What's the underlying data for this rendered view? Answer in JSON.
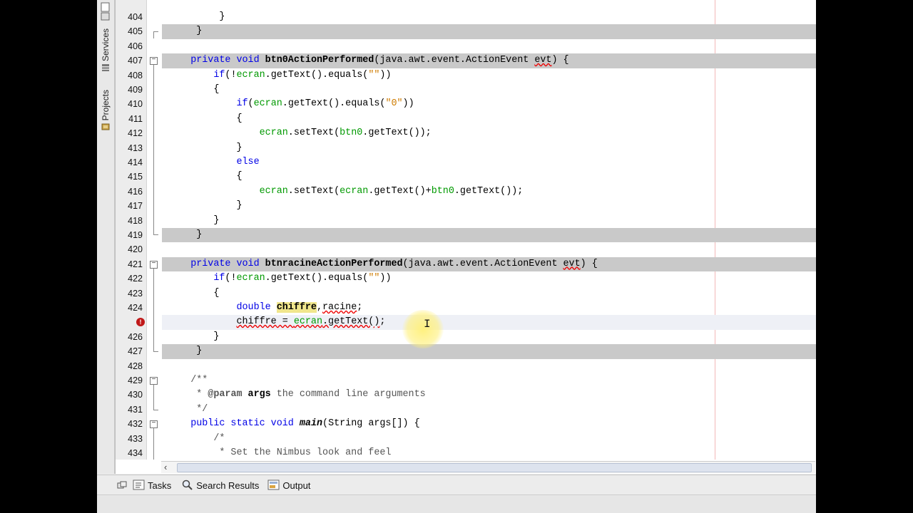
{
  "left_tabs": {
    "services": "Services",
    "projects": "Projects"
  },
  "bottom_tabs": [
    {
      "label": "Tasks",
      "icon": "tasks-icon"
    },
    {
      "label": "Search Results",
      "icon": "search-icon"
    },
    {
      "label": "Output",
      "icon": "output-icon"
    }
  ],
  "editor": {
    "line_numbers": [
      "404",
      "405",
      "406",
      "407",
      "408",
      "409",
      "410",
      "411",
      "412",
      "413",
      "414",
      "415",
      "416",
      "417",
      "418",
      "419",
      "420",
      "421",
      "422",
      "423",
      "424",
      "425",
      "426",
      "427",
      "428",
      "429",
      "430",
      "431",
      "432",
      "433",
      "434"
    ],
    "colors": {
      "keyword": "#0000e6",
      "string": "#ce7b00",
      "field": "#009900",
      "highlight": "#c9c9c9",
      "error": "#c01818"
    }
  },
  "code": {
    "l404": "}",
    "l405": "}",
    "l407_kw": "private void ",
    "l407_name": "btn0ActionPerformed",
    "l407_rest": "(java.awt.event.ActionEvent ",
    "l407_param": "evt",
    "l407_end": ") {",
    "l408_kw": "if",
    "l408_a": "(!",
    "l408_field": "ecran",
    "l408_b": ".getText().equals(",
    "l408_str": "\"\"",
    "l408_c": "))",
    "l409": "{",
    "l410_kw": "if",
    "l410_a": "(",
    "l410_field": "ecran",
    "l410_b": ".getText().equals(",
    "l410_str": "\"0\"",
    "l410_c": "))",
    "l411": "{",
    "l412_field": "ecran",
    "l412_a": ".setText(",
    "l412_field2": "btn0",
    "l412_b": ".getText());",
    "l413": "}",
    "l414_kw": "else",
    "l415": "{",
    "l416_field": "ecran",
    "l416_a": ".setText(",
    "l416_field2": "ecran",
    "l416_b": ".getText()+",
    "l416_field3": "btn0",
    "l416_c": ".getText());",
    "l417": "}",
    "l418": "}",
    "l419": "}",
    "l421_kw": "private void ",
    "l421_name": "btnracineActionPerformed",
    "l421_rest": "(java.awt.event.ActionEvent ",
    "l421_param": "evt",
    "l421_end": ") {",
    "l422_kw": "if",
    "l422_a": "(!",
    "l422_field": "ecran",
    "l422_b": ".getText().equals(",
    "l422_str": "\"\"",
    "l422_c": "))",
    "l423": "{",
    "l424_kw": "double ",
    "l424_var1": "chiffre",
    "l424_sep": ",",
    "l424_var2": "racine",
    "l424_end": ";",
    "l425_var": "chiffre",
    "l425_a": " = ",
    "l425_field": "ecran",
    "l425_b": ".getText()",
    "l425_c": ";",
    "l426": "}",
    "l427": "}",
    "l429": "/**",
    "l430_a": " * ",
    "l430_tag": "@param",
    "l430_b": " args",
    "l430_c": " the command line arguments",
    "l431": " */",
    "l432_kw": "public static void ",
    "l432_name": "main",
    "l432_rest": "(String args[]) {",
    "l433": "/*",
    "l434": " * Set the Nimbus look and feel"
  }
}
